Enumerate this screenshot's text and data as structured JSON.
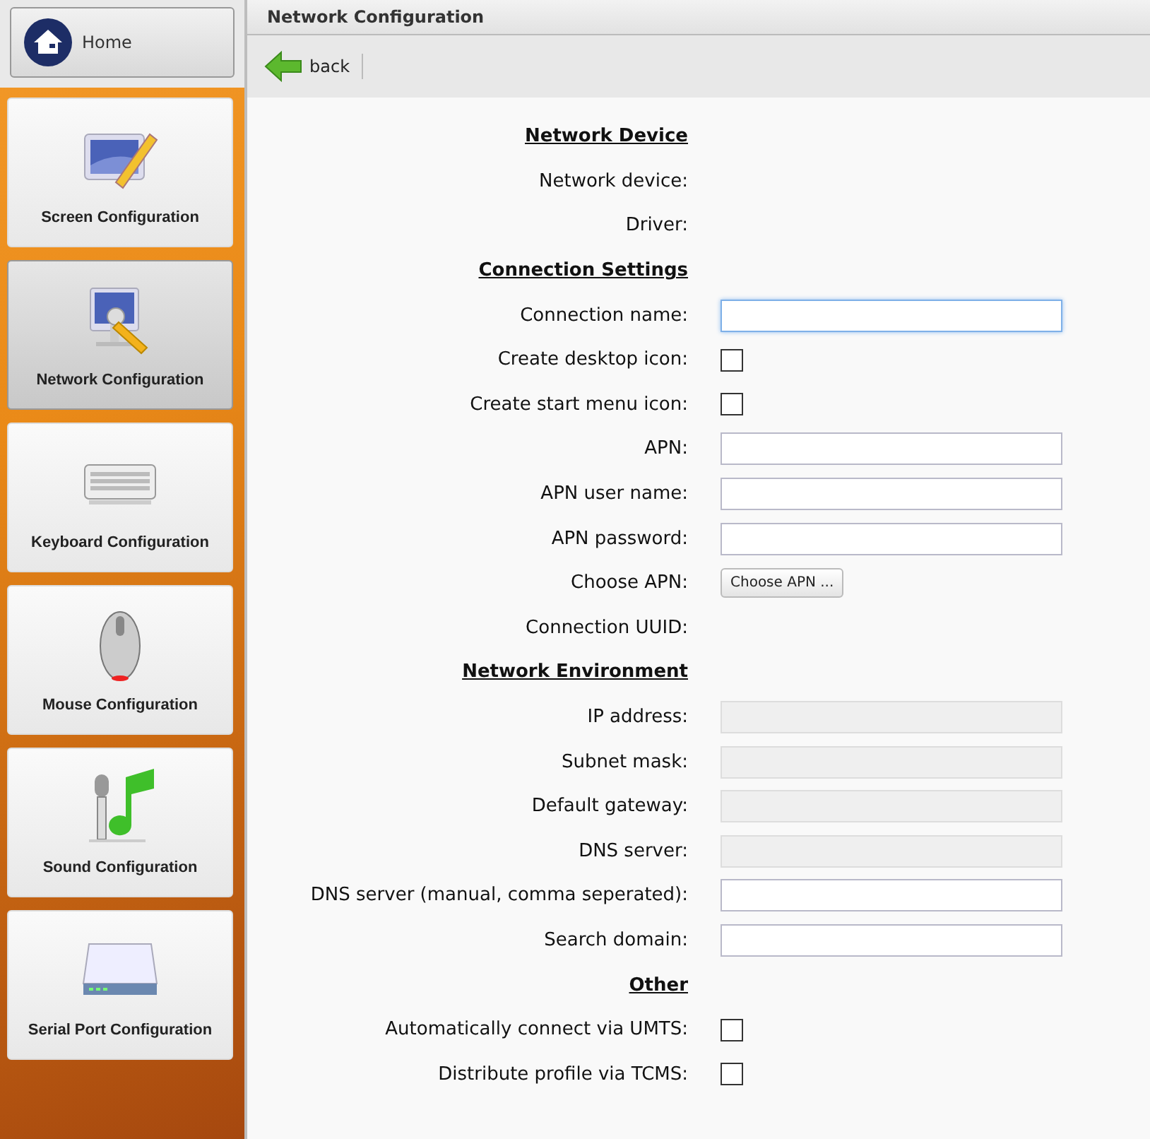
{
  "sidebar": {
    "home": {
      "label": "Home"
    },
    "items": [
      {
        "label": "Screen Configuration",
        "selected": false
      },
      {
        "label": "Network Configuration",
        "selected": true
      },
      {
        "label": "Keyboard Configuration",
        "selected": false
      },
      {
        "label": "Mouse Configuration",
        "selected": false
      },
      {
        "label": "Sound Configuration",
        "selected": false
      },
      {
        "label": "Serial Port Configuration",
        "selected": false
      }
    ]
  },
  "panel": {
    "title": "Network Configuration",
    "toolbar": {
      "back": "back"
    }
  },
  "sections": [
    {
      "title": "Network Device",
      "rows": [
        {
          "label": "Network device:",
          "kind": "text"
        },
        {
          "label": "Driver:",
          "kind": "text"
        }
      ]
    },
    {
      "title": "Connection Settings",
      "rows": [
        {
          "label": "Connection name:",
          "kind": "input",
          "focused": true,
          "disabled": false
        },
        {
          "label": "Create desktop icon:",
          "kind": "checkbox",
          "checked": false
        },
        {
          "label": "Create start menu icon:",
          "kind": "checkbox",
          "checked": false
        },
        {
          "label": "APN:",
          "kind": "input",
          "focused": false,
          "disabled": false
        },
        {
          "label": "APN user name:",
          "kind": "input",
          "focused": false,
          "disabled": false
        },
        {
          "label": "APN password:",
          "kind": "input",
          "focused": false,
          "disabled": false
        },
        {
          "label": "Choose APN:",
          "kind": "button",
          "button": "Choose APN ..."
        },
        {
          "label": "Connection UUID:",
          "kind": "text"
        }
      ]
    },
    {
      "title": "Network Environment",
      "rows": [
        {
          "label": "IP address:",
          "kind": "input",
          "focused": false,
          "disabled": true
        },
        {
          "label": "Subnet mask:",
          "kind": "input",
          "focused": false,
          "disabled": true
        },
        {
          "label": "Default gateway:",
          "kind": "input",
          "focused": false,
          "disabled": true
        },
        {
          "label": "DNS server:",
          "kind": "input",
          "focused": false,
          "disabled": true
        },
        {
          "label": "DNS server (manual, comma seperated):",
          "kind": "input",
          "focused": false,
          "disabled": false
        },
        {
          "label": "Search domain:",
          "kind": "input",
          "focused": false,
          "disabled": false
        }
      ]
    },
    {
      "title": "Other",
      "rows": [
        {
          "label": "Automatically connect via UMTS:",
          "kind": "checkbox",
          "checked": false
        },
        {
          "label": "Distribute profile via TCMS:",
          "kind": "checkbox",
          "checked": false
        }
      ]
    }
  ]
}
